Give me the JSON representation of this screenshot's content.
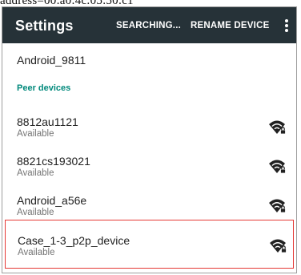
{
  "caption_text": "address=00:a0:4c:05:50:c1",
  "app_bar": {
    "title": "Settings",
    "action_search": "SEARCHING...",
    "action_rename": "RENAME DEVICE",
    "overflow_icon": "more-vert-icon"
  },
  "this_device": {
    "name": "Android_9811"
  },
  "peer_section": {
    "header": "Peer devices"
  },
  "peers": [
    {
      "name": "8812au1121",
      "status": "Available",
      "icon": "wifi-lock-icon"
    },
    {
      "name": "8821cs193021",
      "status": "Available",
      "icon": "wifi-lock-icon"
    },
    {
      "name": "Android_a56e",
      "status": "Available",
      "icon": "wifi-lock-icon"
    },
    {
      "name": "Case_1-3_p2p_device",
      "status": "Available",
      "icon": "wifi-lock-icon",
      "highlighted": true
    }
  ],
  "colors": {
    "app_bar": "#263238",
    "section_header": "#00897b",
    "highlight_border": "#e53935",
    "wifi_icon": "#212121"
  }
}
